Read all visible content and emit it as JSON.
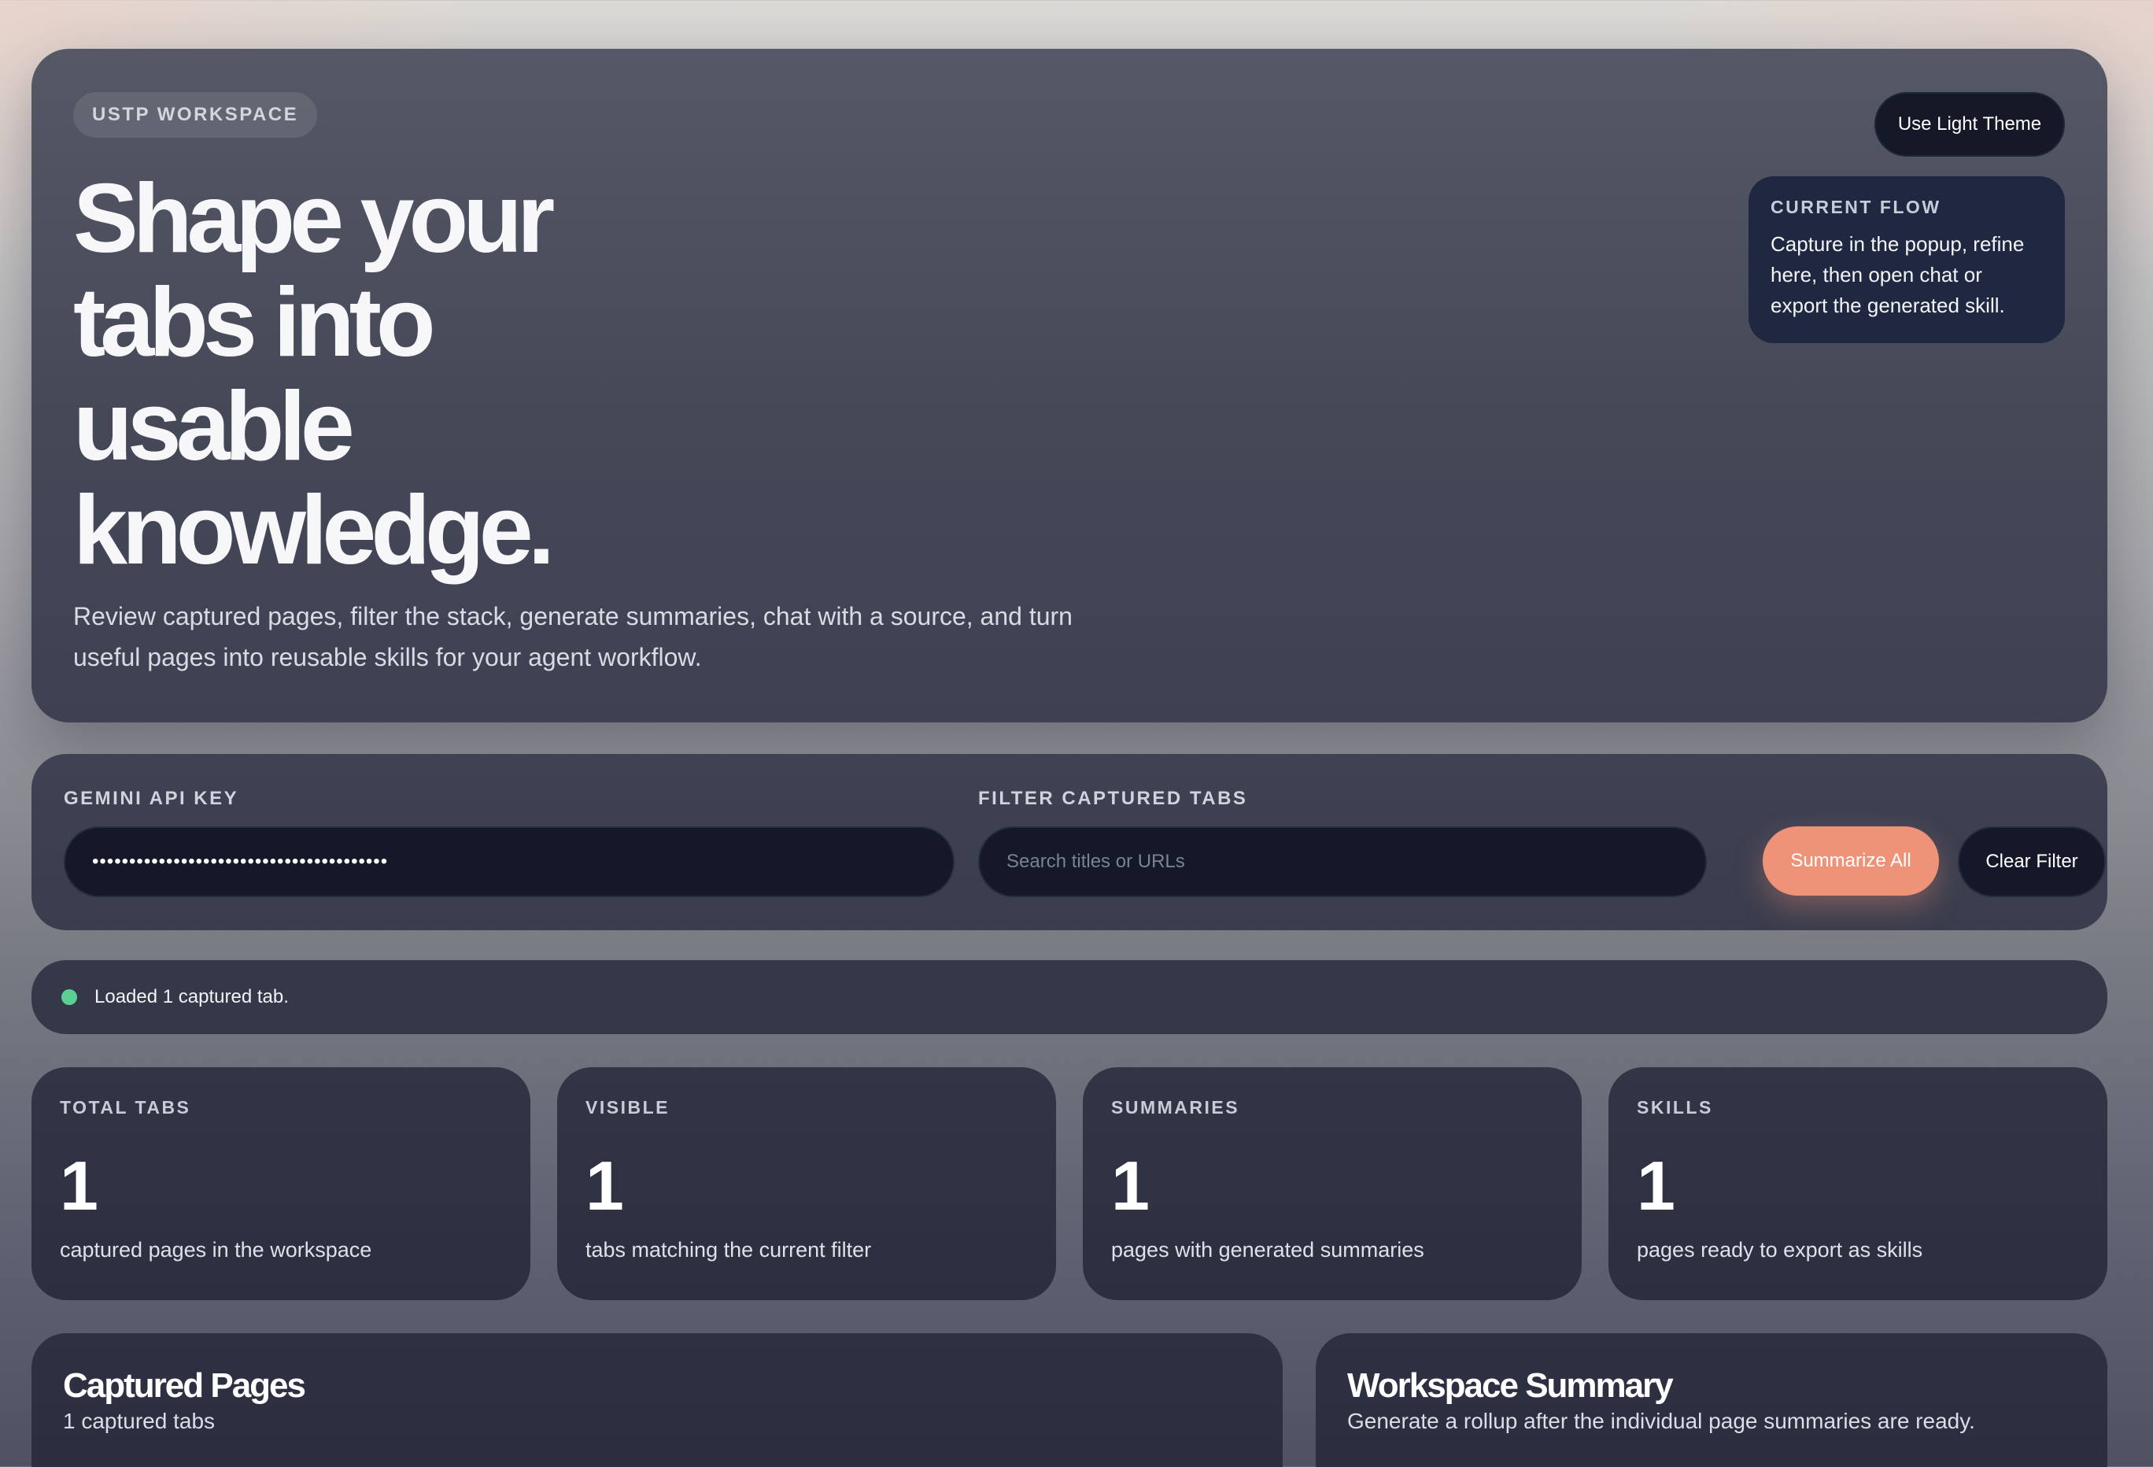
{
  "hero": {
    "badge": "USTP WORKSPACE",
    "title_lines": [
      "Shape your",
      "tabs into",
      "usable",
      "knowledge."
    ],
    "description": "Review captured pages, filter the stack, generate summaries, chat with a source, and turn useful pages into reusable skills for your agent workflow.",
    "theme_button": "Use Light Theme",
    "flow": {
      "label": "CURRENT FLOW",
      "text": "Capture in the popup, refine here, then open chat or export the generated skill."
    }
  },
  "controls": {
    "api_key_label": "GEMINI API KEY",
    "api_key_value": "••••••••••••••••••••••••••••••••••••••••",
    "filter_label": "FILTER CAPTURED TABS",
    "filter_value": "",
    "filter_placeholder": "Search titles or URLs",
    "summarize_button": "Summarize All",
    "clear_button": "Clear Filter"
  },
  "status": {
    "text": "Loaded 1 captured tab.",
    "color": "#5ccf95"
  },
  "stats": [
    {
      "label": "TOTAL TABS",
      "value": "1",
      "sub": "captured pages in the workspace"
    },
    {
      "label": "VISIBLE",
      "value": "1",
      "sub": "tabs matching the current filter"
    },
    {
      "label": "SUMMARIES",
      "value": "1",
      "sub": "pages with generated summaries"
    },
    {
      "label": "SKILLS",
      "value": "1",
      "sub": "pages ready to export as skills"
    }
  ],
  "panels": {
    "captured": {
      "title": "Captured Pages",
      "sub": "1 captured tabs"
    },
    "workspace": {
      "title": "Workspace Summary",
      "sub": "Generate a rollup after the individual page summaries are ready."
    }
  },
  "colors": {
    "accent": "#ee9378",
    "panel": "#2e3142",
    "input": "#141828"
  }
}
